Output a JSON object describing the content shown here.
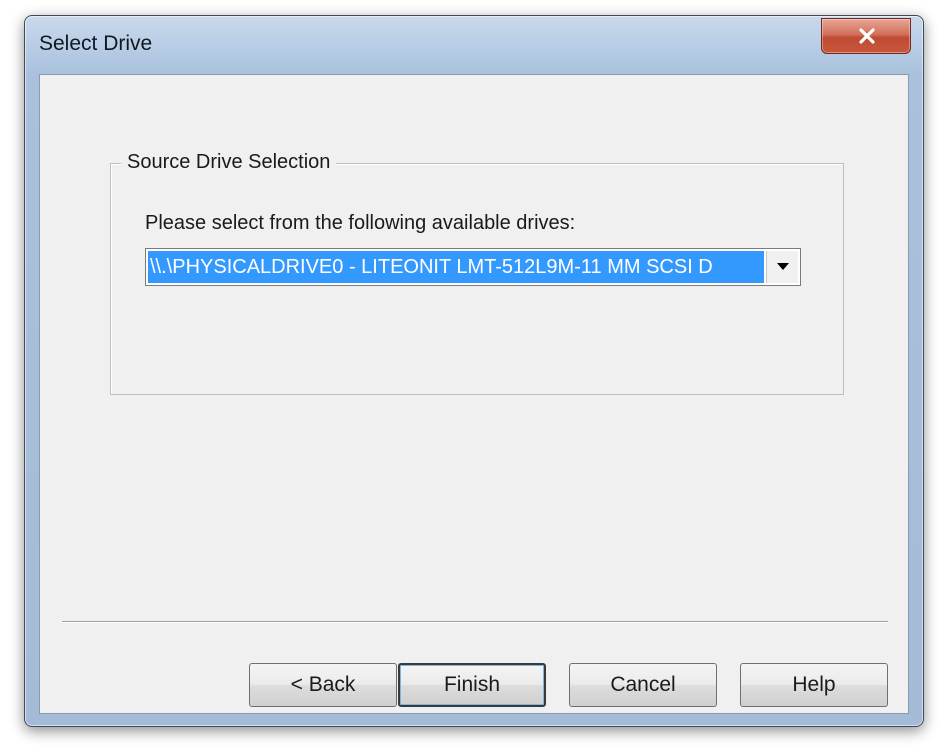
{
  "window": {
    "title": "Select Drive"
  },
  "icons": {
    "close": "close-icon",
    "dropdown": "chevron-down-icon"
  },
  "group": {
    "legend": "Source Drive Selection",
    "prompt": "Please select from the following available drives:",
    "drive_select": {
      "selected_value": "\\\\.\\PHYSICALDRIVE0 - LITEONIT LMT-512L9M-11 MM SCSI D"
    }
  },
  "buttons": {
    "back": "< Back",
    "finish": "Finish",
    "cancel": "Cancel",
    "help": "Help"
  },
  "colors": {
    "selection": "#3399ff",
    "close_button": "#c9573e",
    "title_bar": "#b8cde6"
  }
}
